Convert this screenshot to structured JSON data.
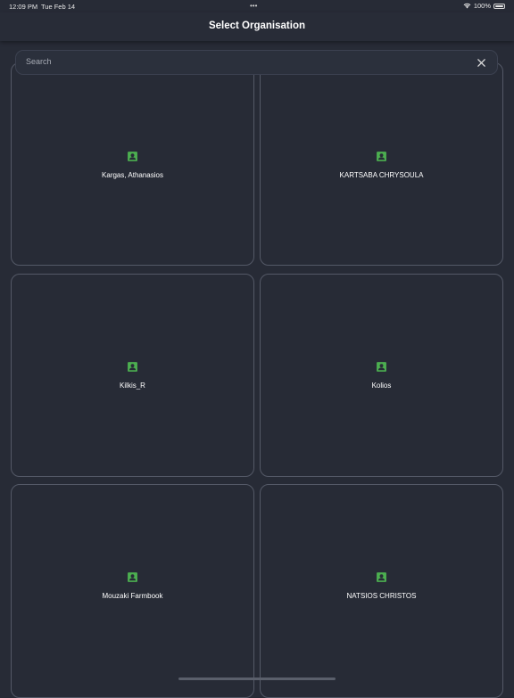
{
  "status_bar": {
    "time": "12:09 PM",
    "date": "Tue Feb 14",
    "dots": "•••",
    "battery": "100%"
  },
  "header": {
    "title": "Select Organisation"
  },
  "search": {
    "placeholder": "Search",
    "value": ""
  },
  "colors": {
    "background": "#272b36",
    "card_border": "#545967",
    "icon_green": "#4caf50"
  },
  "organisations": [
    {
      "name": "Kargas, Athanasios",
      "icon": "account-box-icon"
    },
    {
      "name": "KARTSABA CHRYSOULA",
      "icon": "account-box-icon"
    },
    {
      "name": "Kilkis_R",
      "icon": "account-box-icon"
    },
    {
      "name": "Kolios",
      "icon": "account-box-icon"
    },
    {
      "name": "Mouzaki Farmbook",
      "icon": "account-box-icon"
    },
    {
      "name": "NATSIOS CHRISTOS",
      "icon": "account-box-icon"
    }
  ]
}
